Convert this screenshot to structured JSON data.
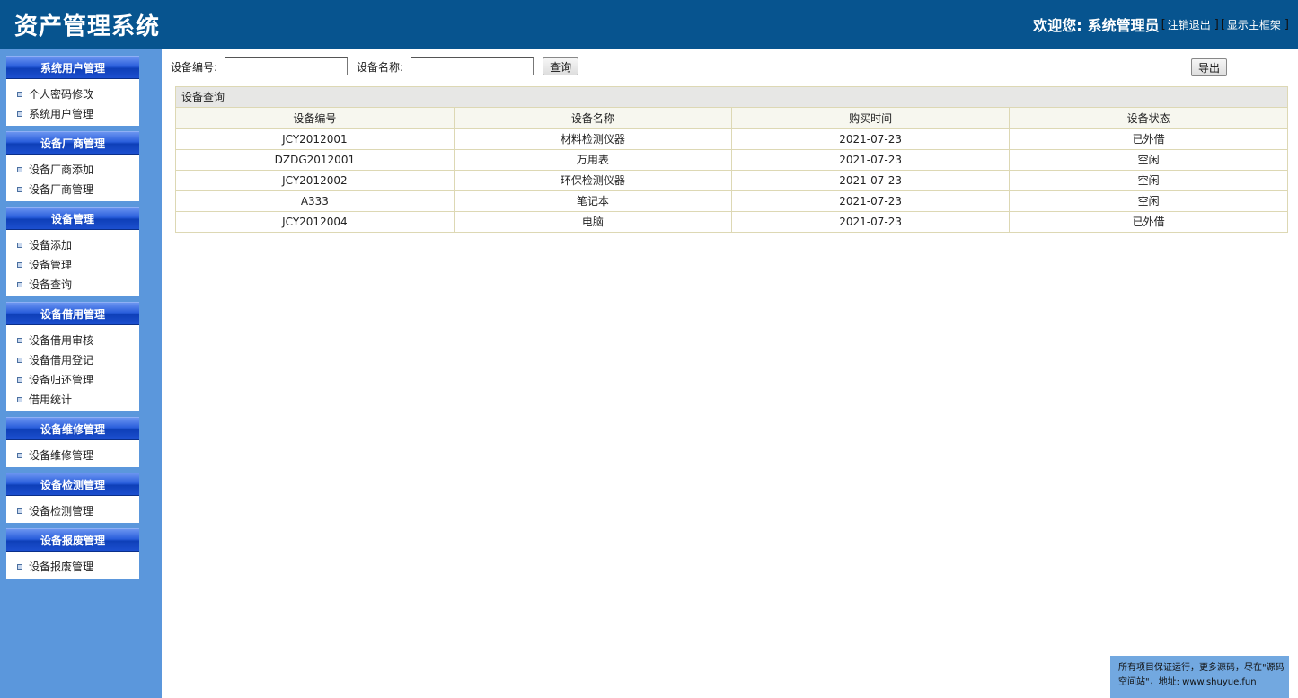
{
  "header": {
    "title": "资产管理系统",
    "welcome": "欢迎您:",
    "username": "系统管理员",
    "logout": "注销退出",
    "show_frame": "显示主框架"
  },
  "sidebar": {
    "groups": [
      {
        "title": "系统用户管理",
        "items": [
          "个人密码修改",
          "系统用户管理"
        ]
      },
      {
        "title": "设备厂商管理",
        "items": [
          "设备厂商添加",
          "设备厂商管理"
        ]
      },
      {
        "title": "设备管理",
        "items": [
          "设备添加",
          "设备管理",
          "设备查询"
        ]
      },
      {
        "title": "设备借用管理",
        "items": [
          "设备借用审核",
          "设备借用登记",
          "设备归还管理",
          "借用统计"
        ]
      },
      {
        "title": "设备维修管理",
        "items": [
          "设备维修管理"
        ]
      },
      {
        "title": "设备检测管理",
        "items": [
          "设备检测管理"
        ]
      },
      {
        "title": "设备报废管理",
        "items": [
          "设备报废管理"
        ]
      }
    ]
  },
  "search": {
    "code_label": "设备编号:",
    "code_value": "",
    "name_label": "设备名称:",
    "name_value": "",
    "query_button": "查询",
    "export_button": "导出"
  },
  "panel": {
    "title": "设备查询",
    "columns": [
      "设备编号",
      "设备名称",
      "购买时间",
      "设备状态"
    ],
    "rows": [
      [
        "JCY2012001",
        "材料检测仪器",
        "2021-07-23",
        "已外借"
      ],
      [
        "DZDG2012001",
        "万用表",
        "2021-07-23",
        "空闲"
      ],
      [
        "JCY2012002",
        "环保检测仪器",
        "2021-07-23",
        "空闲"
      ],
      [
        "A333",
        "笔记本",
        "2021-07-23",
        "空闲"
      ],
      [
        "JCY2012004",
        "电脑",
        "2021-07-23",
        "已外借"
      ]
    ]
  },
  "notice": {
    "line1": "所有项目保证运行，更多源码，尽在\"源码",
    "line2": "空间站\"，地址: www.shuyue.fun"
  },
  "colors": {
    "header_bg": "#07548f",
    "sidebar_bg": "#5b97dc",
    "notice_bg": "#72a8e0"
  }
}
